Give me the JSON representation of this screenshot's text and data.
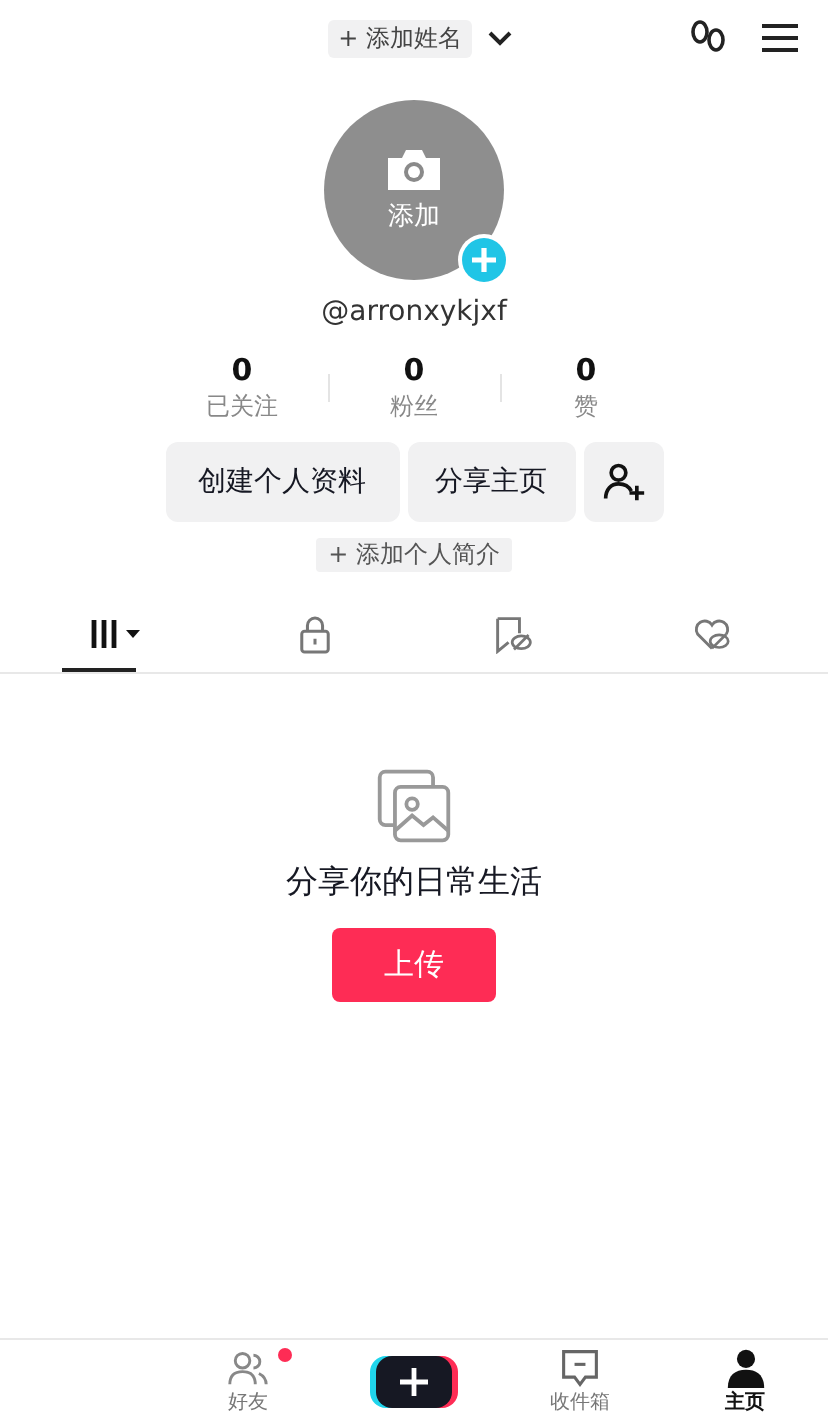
{
  "header": {
    "name_button": "+ 添加姓名"
  },
  "avatar": {
    "label": "添加"
  },
  "username": "@arronxykjxf",
  "stats": [
    {
      "value": "0",
      "label": "已关注"
    },
    {
      "value": "0",
      "label": "粉丝"
    },
    {
      "value": "0",
      "label": "赞"
    }
  ],
  "buttons": [
    "创建个人资料",
    "分享主页"
  ],
  "bio_button": "+ 添加个人简介",
  "tabs": [
    {
      "kind": "works",
      "selected": true
    },
    {
      "kind": "private",
      "selected": false
    },
    {
      "kind": "saved",
      "selected": false
    },
    {
      "kind": "liked",
      "selected": false
    }
  ],
  "empty": {
    "message": "分享你的日常生活",
    "button": "上传"
  },
  "nav": [
    {
      "kind": "blank"
    },
    {
      "kind": "friends",
      "label": "好友",
      "badge": true,
      "selected": false
    },
    {
      "kind": "create"
    },
    {
      "kind": "inbox",
      "label": "收件箱",
      "selected": false
    },
    {
      "kind": "profile",
      "label": "主页",
      "selected": true
    }
  ]
}
